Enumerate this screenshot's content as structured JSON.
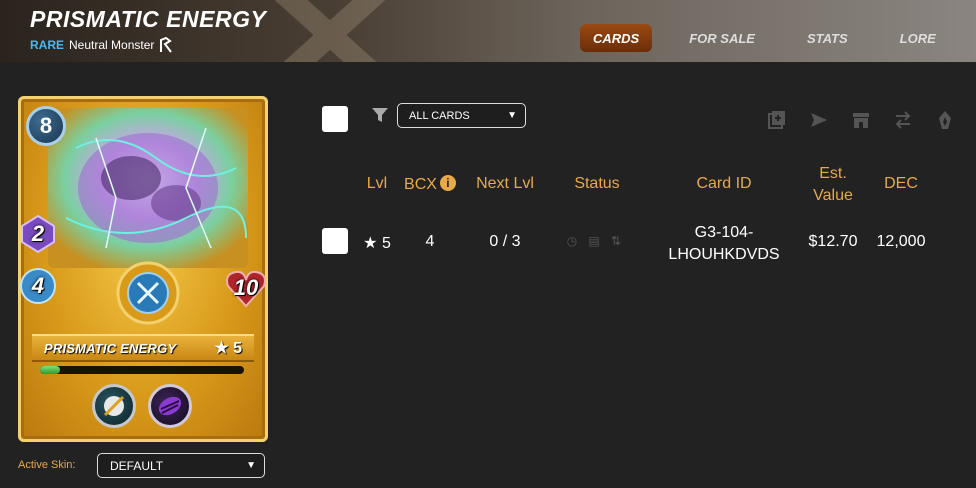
{
  "header": {
    "title": "PRISMATIC ENERGY",
    "rarity": "RARE",
    "type": "Neutral Monster",
    "tabs": [
      {
        "label": "CARDS",
        "active": true
      },
      {
        "label": "FOR SALE",
        "active": false
      },
      {
        "label": "STATS",
        "active": false
      },
      {
        "label": "LORE",
        "active": false
      }
    ]
  },
  "card": {
    "mana": "8",
    "magic": "2",
    "speed": "4",
    "health": "10",
    "name": "PRISMATIC ENERGY",
    "level": "★ 5",
    "xp_fraction": 0.1,
    "abilities": [
      "shield-bow-icon",
      "purple-orb-icon"
    ]
  },
  "skin": {
    "label": "Active Skin:",
    "selected": "DEFAULT"
  },
  "filter": {
    "selected": "ALL CARDS"
  },
  "toolbar_icons": [
    "combine-icon",
    "send-icon",
    "market-icon",
    "transfer-icon",
    "burn-icon"
  ],
  "table": {
    "headers": {
      "lvl": "Lvl",
      "bcx": "BCX",
      "next_lvl": "Next Lvl",
      "status": "Status",
      "card_id": "Card ID",
      "est_value_1": "Est.",
      "est_value_2": "Value",
      "dec": "DEC"
    },
    "rows": [
      {
        "lvl": "★ 5",
        "bcx": "4",
        "next_lvl": "0 / 3",
        "card_id_1": "G3-104-",
        "card_id_2": "LHOUHKDVDS",
        "est_value": "$12.70",
        "dec": "12,000"
      }
    ]
  },
  "colors": {
    "accent": "#e8a94a",
    "rarity": "#4ab7f0",
    "active_tab": "#8a3e10",
    "background": "#222222"
  }
}
